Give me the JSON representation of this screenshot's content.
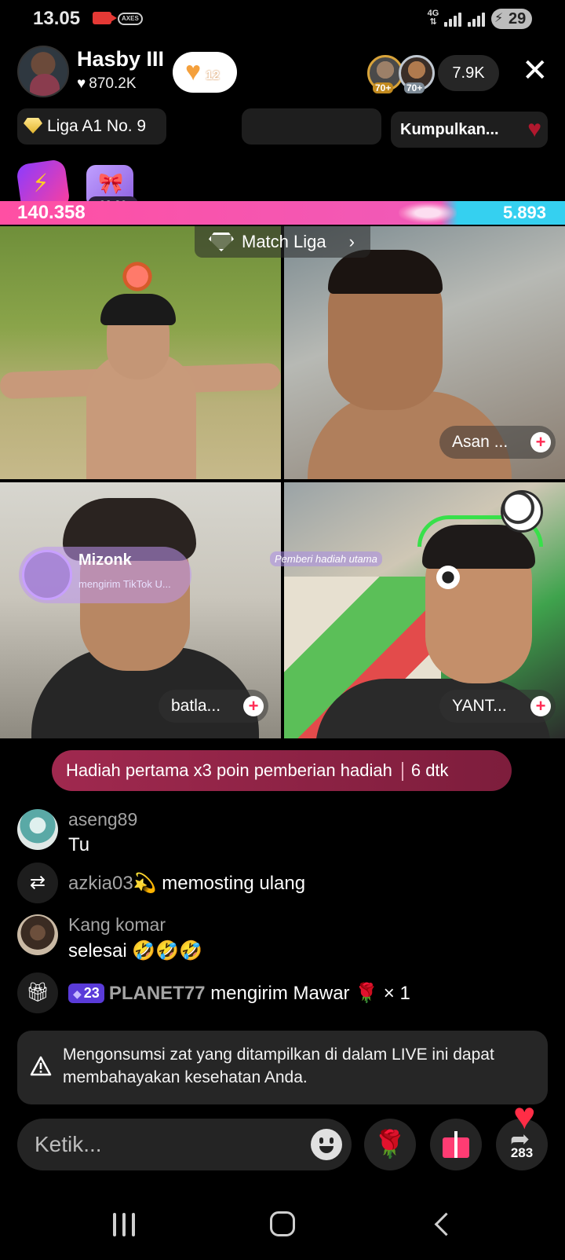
{
  "status_bar": {
    "time": "13.05",
    "axes_label": "AXES",
    "network_type": "4G",
    "battery": "29"
  },
  "host": {
    "name": "Hasby III",
    "likes": "870.2K",
    "follow_badge_count": "12"
  },
  "viewers": {
    "levels": [
      "70+",
      "70+"
    ],
    "count": "7.9K"
  },
  "badges": {
    "liga": "Liga A1 No. 9",
    "collect": "Kumpulkan..."
  },
  "game": {
    "timer": "02:29"
  },
  "battle": {
    "left_score": "140.358",
    "right_score": "5.893",
    "left_fraction": 0.96,
    "colors": {
      "left": "#ff4fa3",
      "right": "#35d0f0"
    }
  },
  "match": {
    "label": "Match Liga",
    "guests": [
      {
        "name": "Asan ..."
      },
      {
        "name": "batla..."
      },
      {
        "name": "YANT..."
      }
    ],
    "gift_overlay": {
      "user": "Mizonk",
      "sub": "mengirim TikTok U..."
    },
    "gift_label": "Pemberi hadiah utama"
  },
  "promo": {
    "text": "Hadiah pertama x3 poin pemberian hadiah",
    "countdown": "6 dtk"
  },
  "chat": [
    {
      "user": "aseng89",
      "text": "Tu"
    },
    {
      "user": "azkia03",
      "user_emoji": "💫",
      "action": "memosting ulang"
    },
    {
      "user": "Kang komar",
      "text": "selesai 🤣🤣🤣"
    },
    {
      "level": "23",
      "user": "PLANET77",
      "action": "mengirim Mawar",
      "gift_emoji": "🌹",
      "quantity": "× 1"
    }
  ],
  "warning": {
    "text": "Mengonsumsi zat yang ditampilkan di dalam LIVE ini dapat membahayakan kesehatan Anda."
  },
  "composer": {
    "placeholder": "Ketik...",
    "rose_emoji": "🌹",
    "share_count": "283"
  },
  "icons": {
    "heart": "heart-icon",
    "close": "close-icon",
    "smile": "smile-icon",
    "gift": "gift-icon",
    "repost": "repost-icon",
    "share": "share-icon"
  }
}
